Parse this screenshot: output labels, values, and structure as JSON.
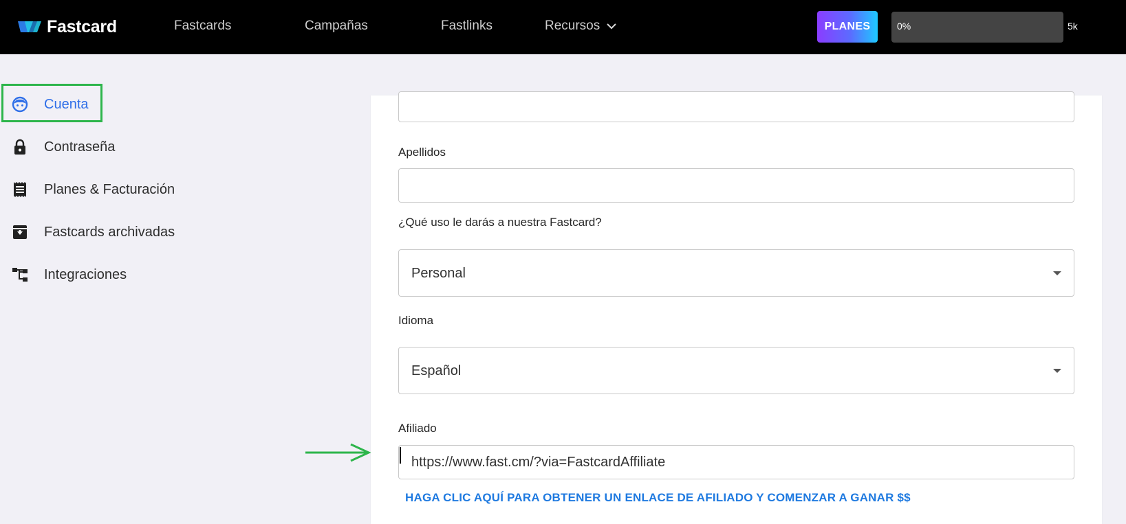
{
  "brand": {
    "name": "Fastcard"
  },
  "nav": {
    "items": [
      "Fastcards",
      "Campañas",
      "Fastlinks",
      "Recursos"
    ],
    "planes_label": "PLANES",
    "usage": {
      "percent_label": "0%",
      "fraction": 0.0,
      "max_label": "5k"
    }
  },
  "sidebar": {
    "items": [
      {
        "label": "Cuenta",
        "icon": "face-icon",
        "active": true
      },
      {
        "label": "Contraseña",
        "icon": "lock-icon"
      },
      {
        "label": "Planes & Facturación",
        "icon": "receipt-icon"
      },
      {
        "label": "Fastcards archivadas",
        "icon": "archive-icon"
      },
      {
        "label": "Integraciones",
        "icon": "integrations-icon"
      }
    ]
  },
  "form": {
    "apellidos_label": "Apellidos",
    "apellidos_value": "",
    "uso_label": "¿Qué uso le darás a nuestra Fastcard?",
    "uso_value": "Personal",
    "idioma_label": "Idioma",
    "idioma_value": "Español",
    "afiliado_label": "Afiliado",
    "afiliado_value": "https://www.fast.cm/?via=FastcardAffiliate",
    "afiliado_link": "HAGA CLIC AQUÍ PARA OBTENER UN ENLACE DE AFILIADO Y COMENZAR A GANAR $$"
  },
  "colors": {
    "active_accent": "#2f6fe8",
    "highlight_box": "#2db54b",
    "link": "#1f7ae0"
  }
}
